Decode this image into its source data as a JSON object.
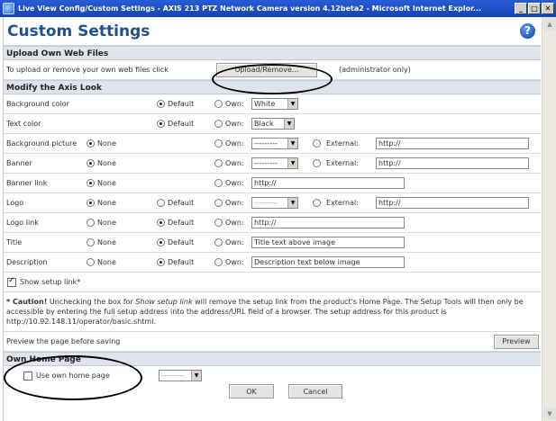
{
  "window": {
    "title": "Live View Config/Custom Settings - AXIS 213 PTZ Network Camera version 4.12beta2 - Microsoft Internet Explor...",
    "minimize": "_",
    "maximize": "□",
    "close": "✕"
  },
  "page": {
    "title": "Custom Settings",
    "help_glyph": "?"
  },
  "upload": {
    "header": "Upload Own Web Files",
    "text": "To upload or remove your own web files click",
    "button": "Upload/Remove...",
    "note": "(administrator only)"
  },
  "look": {
    "header": "Modify the Axis Look",
    "options": {
      "none": "None",
      "default": "Default",
      "own": "Own:",
      "external": "External:"
    },
    "rows": [
      {
        "label": "Background color",
        "own_value": "White"
      },
      {
        "label": "Text color",
        "own_value": "Black"
      },
      {
        "label": "Background picture",
        "own_value": "---------",
        "external_value": "http://"
      },
      {
        "label": "Banner",
        "own_value": "---------",
        "external_value": "http://"
      },
      {
        "label": "Banner link",
        "own_value": "http://"
      },
      {
        "label": "Logo",
        "own_value": "---------",
        "external_value": "http://"
      },
      {
        "label": "Logo link",
        "own_value": "http://"
      },
      {
        "label": "Title",
        "own_value": "Title text above image"
      },
      {
        "label": "Description",
        "own_value": "Description text below image"
      }
    ],
    "show_setup_link": "Show setup link*",
    "caution_label": "* Caution!",
    "caution_part1": " Unchecking the box for ",
    "caution_link": "Show setup link",
    "caution_part2": " will remove the setup link from the product's Home Page. The Setup Tools will then only be accessible by entering the full setup address into the address/URL field of a browser. The setup address for this product is http://10.92.148.11/operator/basic.shtml.",
    "preview_text": "Preview the page before saving",
    "preview_button": "Preview"
  },
  "home": {
    "header": "Own Home Page",
    "checkbox_label": "Use own home page",
    "select_value": "---------"
  },
  "actions": {
    "ok": "OK",
    "cancel": "Cancel"
  },
  "scroll": {
    "up": "▲",
    "down": "▼"
  }
}
